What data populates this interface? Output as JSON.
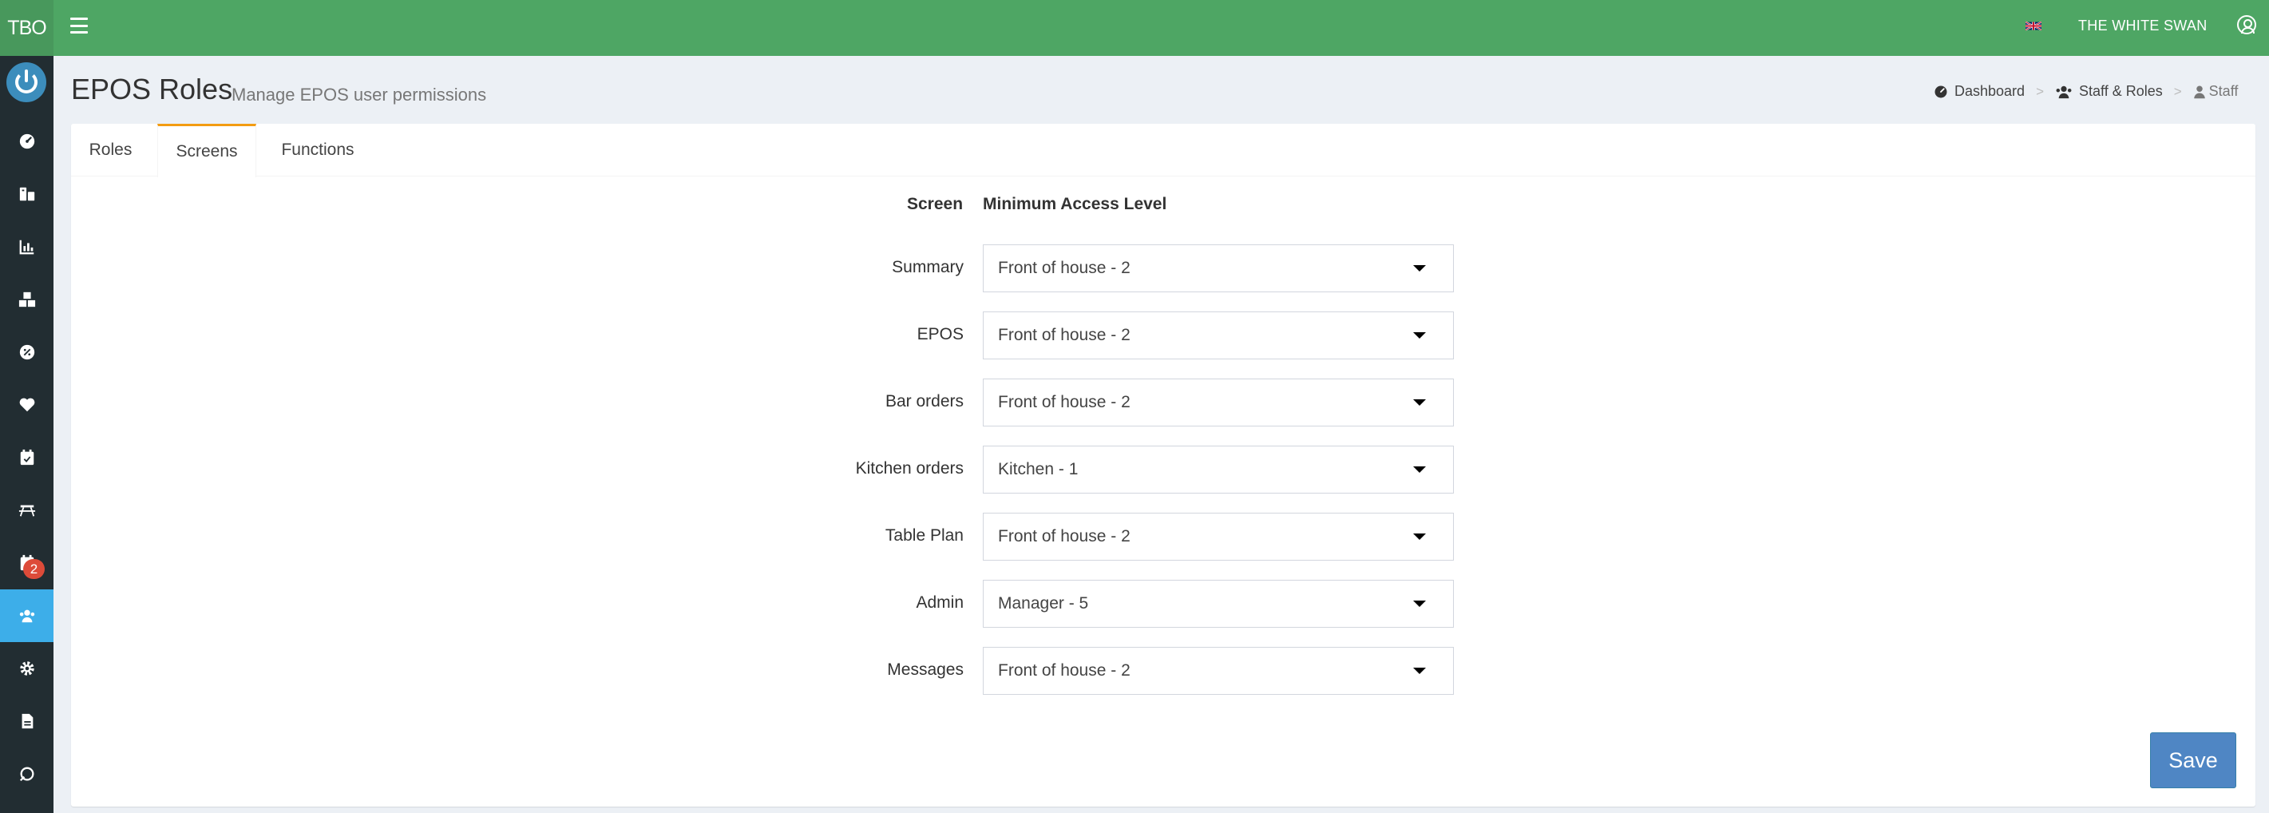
{
  "topbar": {
    "brand": "TBO",
    "venue_name": "THE WHITE SWAN",
    "language_icon": "uk-flag-icon",
    "user_icon": "user-circle-icon"
  },
  "sidebar": {
    "items": [
      {
        "icon": "dashboard-gauge-icon"
      },
      {
        "icon": "products-icon"
      },
      {
        "icon": "reports-chart-icon"
      },
      {
        "icon": "stock-boxes-icon"
      },
      {
        "icon": "discount-percent-icon"
      },
      {
        "icon": "loyalty-heart-icon"
      },
      {
        "icon": "bookings-calendar-check-icon"
      },
      {
        "icon": "tables-picnic-icon"
      },
      {
        "icon": "rota-calendar-icon",
        "badge": "2"
      },
      {
        "icon": "staff-users-icon",
        "active": true
      },
      {
        "icon": "settings-gear-icon"
      },
      {
        "icon": "documents-icon"
      },
      {
        "icon": "sync-icon"
      }
    ]
  },
  "header": {
    "title": "EPOS Roles",
    "subtitle": "Manage EPOS user permissions"
  },
  "breadcrumb": {
    "items": [
      "Dashboard",
      "Staff & Roles",
      "Staff"
    ],
    "separator": ">"
  },
  "tabs": [
    "Roles",
    "Screens",
    "Functions"
  ],
  "active_tab": "Screens",
  "table": {
    "screen_header": "Screen",
    "access_header": "Minimum Access Level",
    "rows": [
      {
        "screen": "Summary",
        "level": "Front of house - 2"
      },
      {
        "screen": "EPOS",
        "level": "Front of house - 2"
      },
      {
        "screen": "Bar orders",
        "level": "Front of house - 2"
      },
      {
        "screen": "Kitchen orders",
        "level": "Kitchen - 1"
      },
      {
        "screen": "Table Plan",
        "level": "Front of house - 2"
      },
      {
        "screen": "Admin",
        "level": "Manager - 5"
      },
      {
        "screen": "Messages",
        "level": "Front of house - 2"
      }
    ]
  },
  "actions": {
    "save_label": "Save"
  },
  "colors": {
    "topbar": "#4ea664",
    "sidebar": "#222d32",
    "sidebar_active": "#3daee9",
    "tab_active_accent": "#f39c12",
    "save_button": "#4f86c4",
    "badge": "#dd4b39"
  }
}
